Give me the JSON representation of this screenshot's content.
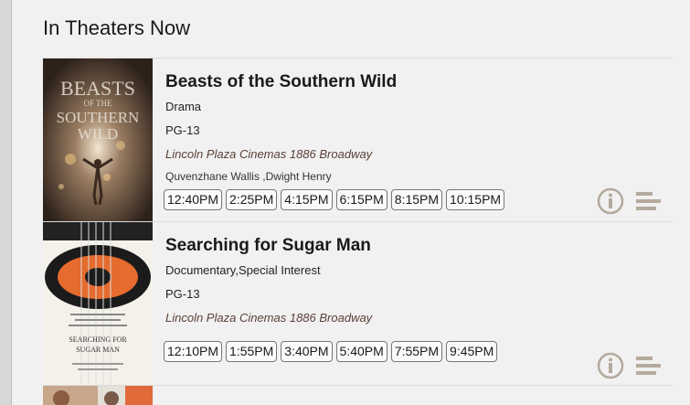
{
  "page": {
    "title": "In Theaters Now"
  },
  "colors": {
    "background": "#f1f1f1",
    "theater_text": "#5a4038",
    "icon": "#b3aa9d"
  },
  "movies": [
    {
      "title": "Beasts of the Southern Wild",
      "genre": "Drama",
      "rating": "PG-13",
      "theater": "Lincoln Plaza Cinemas 1886 Broadway",
      "cast": "Quvenzhane Wallis ,Dwight Henry",
      "showtimes": [
        "12:40PM",
        "2:25PM",
        "4:15PM",
        "6:15PM",
        "8:15PM",
        "10:15PM"
      ],
      "poster_text": [
        "BEASTS",
        "OF THE",
        "SOUTHERN",
        "WILD"
      ],
      "icons": [
        "info-icon",
        "list-icon"
      ]
    },
    {
      "title": "Searching for Sugar Man",
      "genre": "Documentary,Special Interest",
      "rating": "PG-13",
      "theater": "Lincoln Plaza Cinemas 1886 Broadway",
      "cast": "",
      "showtimes": [
        "12:10PM",
        "1:55PM",
        "3:40PM",
        "5:40PM",
        "7:55PM",
        "9:45PM"
      ],
      "poster_text": [
        "SEARCHING FOR",
        "SUGAR MAN"
      ],
      "icons": [
        "info-icon",
        "list-icon"
      ]
    }
  ]
}
